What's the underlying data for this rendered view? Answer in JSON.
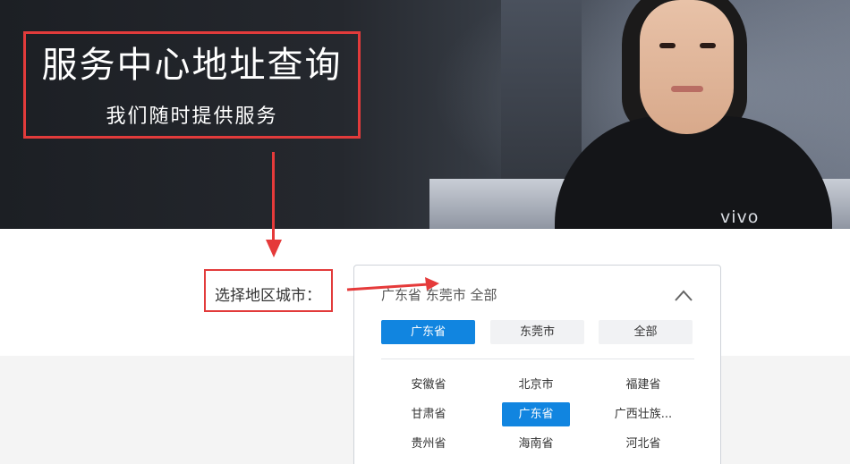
{
  "hero": {
    "title": "服务中心地址查询",
    "subtitle": "我们随时提供服务",
    "brand_logo": "vivo"
  },
  "region_selector": {
    "label": "选择地区城市：",
    "current_value": "广东省 东莞市 全部",
    "tabs": [
      {
        "label": "广东省",
        "active": true
      },
      {
        "label": "东莞市",
        "active": false
      },
      {
        "label": "全部",
        "active": false
      }
    ],
    "options": [
      {
        "label": "安徽省",
        "active": false
      },
      {
        "label": "北京市",
        "active": false
      },
      {
        "label": "福建省",
        "active": false
      },
      {
        "label": "甘肃省",
        "active": false
      },
      {
        "label": "广东省",
        "active": true
      },
      {
        "label": "广西壮族...",
        "active": false
      },
      {
        "label": "贵州省",
        "active": false
      },
      {
        "label": "海南省",
        "active": false
      },
      {
        "label": "河北省",
        "active": false
      }
    ]
  },
  "colors": {
    "accent": "#1185e0",
    "annotation_red": "#e23b3b"
  },
  "icons": {
    "collapse": "chevron-up-icon"
  }
}
